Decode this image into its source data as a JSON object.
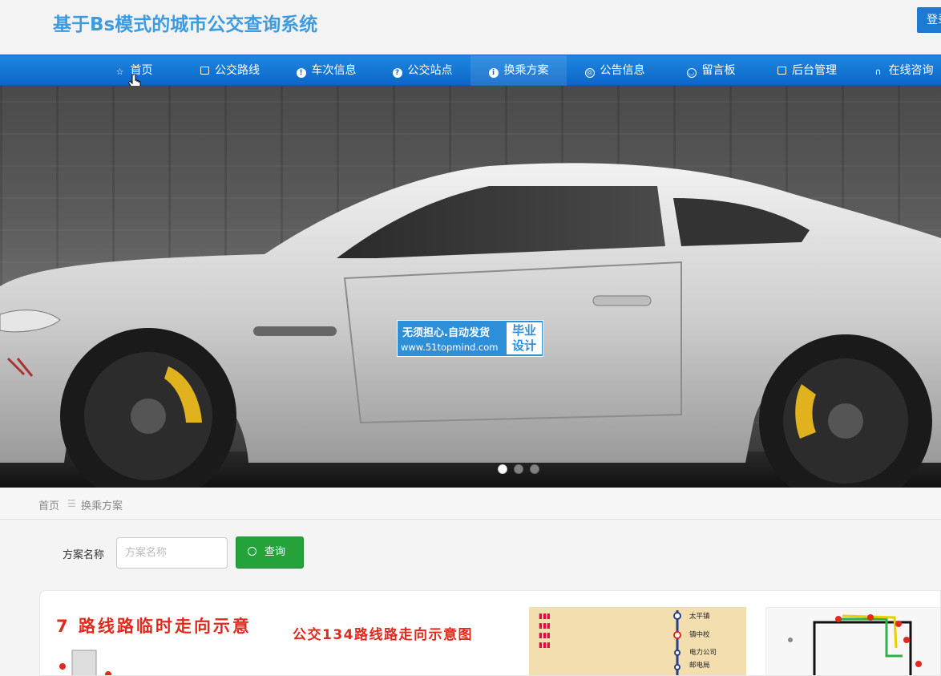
{
  "header": {
    "site_title": "基于Bs模式的城市公交查询系统",
    "login_label": "登录"
  },
  "nav": {
    "items": [
      {
        "label": "首页",
        "icon": "star-icon"
      },
      {
        "label": "公交路线",
        "icon": "bag-icon"
      },
      {
        "label": "车次信息",
        "icon": "info-icon"
      },
      {
        "label": "公交站点",
        "icon": "question-icon"
      },
      {
        "label": "换乘方案",
        "icon": "info-icon"
      },
      {
        "label": "公告信息",
        "icon": "target-icon"
      },
      {
        "label": "留言板",
        "icon": "smile-icon"
      },
      {
        "label": "后台管理",
        "icon": "clipboard-icon"
      },
      {
        "label": "在线咨询",
        "icon": "headset-icon"
      }
    ],
    "active_index": 4
  },
  "banner": {
    "watermark_line1": "无须担心.自动发货",
    "watermark_line2": "www.51topmind.com",
    "watermark_badge": "毕业设计",
    "slide_count": 3,
    "active_slide": 1
  },
  "breadcrumb": {
    "home": "首页",
    "separator": "☰",
    "current": "换乘方案"
  },
  "search": {
    "label": "方案名称",
    "placeholder": "方案名称",
    "value": "",
    "button_label": "查询"
  },
  "cards": {
    "card1_title": "7 路线路临时走向示意",
    "card2_title": "公交134路线路走向示意图",
    "card3_stops": [
      "太平镇",
      "镇中校",
      "电力公司",
      "邮电局"
    ]
  },
  "colors": {
    "title_blue": "#3d9be0",
    "nav_blue": "#0d6acc",
    "button_green": "#23a33a",
    "map_red": "#e02a1e"
  }
}
